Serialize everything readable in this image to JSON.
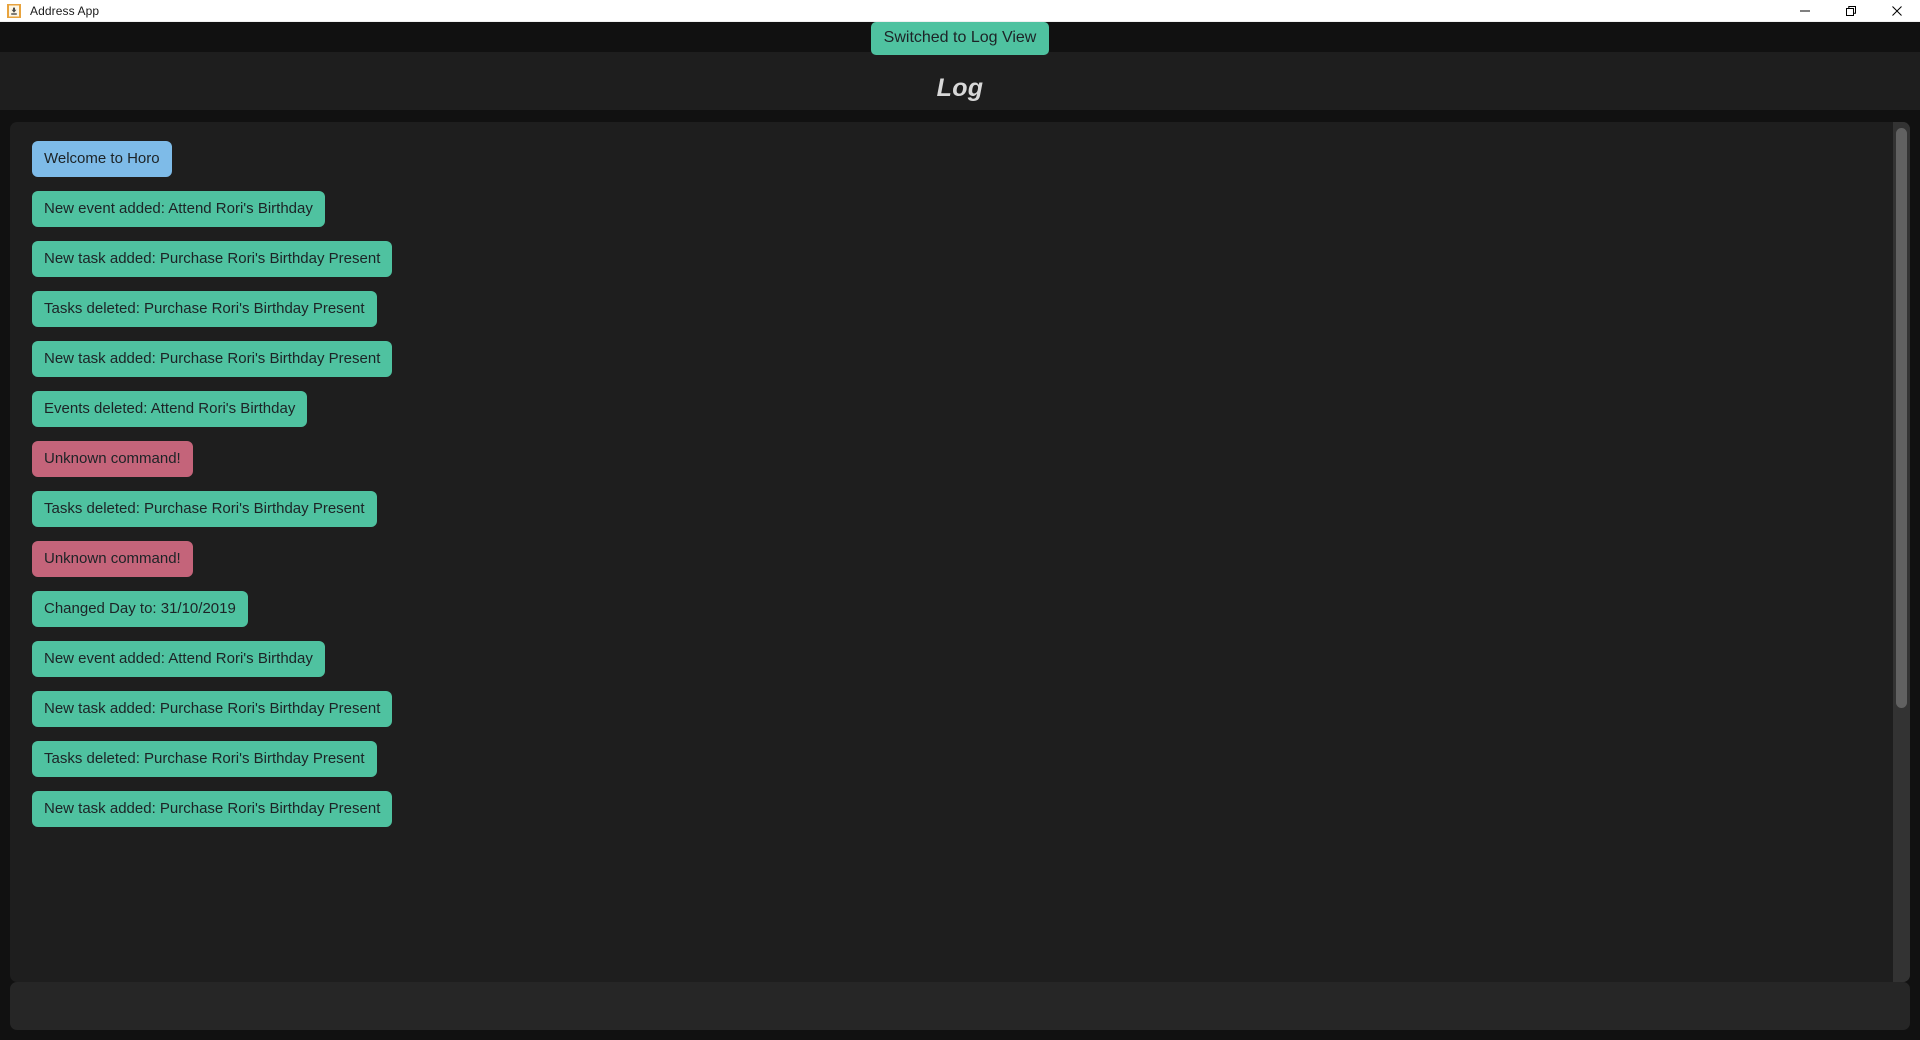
{
  "window": {
    "title": "Address App",
    "icon": "app-icon",
    "controls": [
      {
        "name": "minimize",
        "glyph": "minimize-icon"
      },
      {
        "name": "maximize",
        "glyph": "restore-icon"
      },
      {
        "name": "close",
        "glyph": "close-icon"
      }
    ]
  },
  "toast": {
    "message": "Switched to Log View",
    "color": "#4fc2a0"
  },
  "header": {
    "title": "Log"
  },
  "colors": {
    "background": "#111111",
    "panel": "#1e1e1e",
    "info": "#7ebbe8",
    "success": "#4fc2a0",
    "error": "#c4647a",
    "input_bar": "#262626",
    "scroll_thumb": "#616161",
    "scroll_track": "#333333"
  },
  "log": {
    "entries": [
      {
        "text": "Welcome to Horo",
        "type": "info"
      },
      {
        "text": "New event added: Attend Rori's Birthday",
        "type": "success"
      },
      {
        "text": "New task added: Purchase Rori's Birthday Present",
        "type": "success"
      },
      {
        "text": "Tasks deleted: Purchase Rori's Birthday Present",
        "type": "success"
      },
      {
        "text": "New task added: Purchase Rori's Birthday Present",
        "type": "success"
      },
      {
        "text": "Events deleted: Attend Rori's Birthday",
        "type": "success"
      },
      {
        "text": "Unknown command!",
        "type": "error"
      },
      {
        "text": "Tasks deleted: Purchase Rori's Birthday Present",
        "type": "success"
      },
      {
        "text": "Unknown command!",
        "type": "error"
      },
      {
        "text": "Changed Day to: 31/10/2019",
        "type": "success"
      },
      {
        "text": "New event added: Attend Rori's Birthday",
        "type": "success"
      },
      {
        "text": "New task added: Purchase Rori's Birthday Present",
        "type": "success"
      },
      {
        "text": "Tasks deleted: Purchase Rori's Birthday Present",
        "type": "success"
      },
      {
        "text": "New task added: Purchase Rori's Birthday Present",
        "type": "success"
      }
    ]
  },
  "command": {
    "value": "",
    "placeholder": ""
  }
}
